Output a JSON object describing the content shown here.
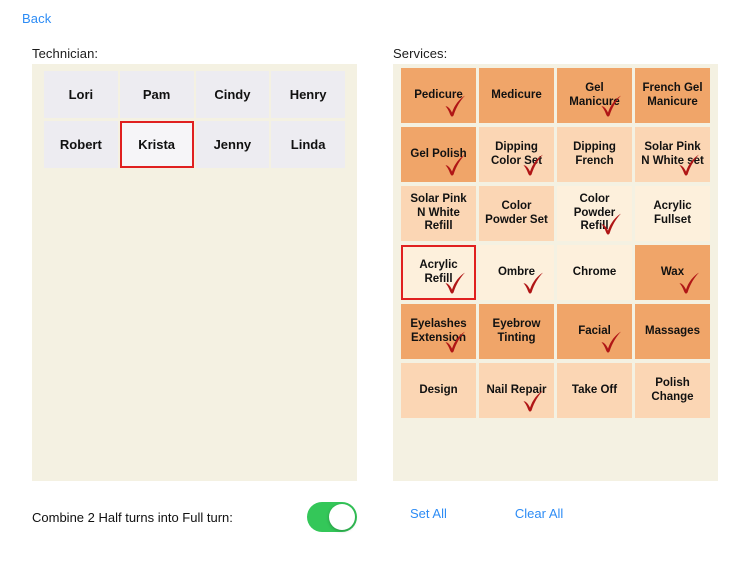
{
  "nav": {
    "back_label": "Back"
  },
  "technician": {
    "label": "Technician:",
    "selected": "Krista",
    "items": [
      {
        "name": "Lori",
        "selected": false
      },
      {
        "name": "Pam",
        "selected": false
      },
      {
        "name": "Cindy",
        "selected": false
      },
      {
        "name": "Henry",
        "selected": false
      },
      {
        "name": "Robert",
        "selected": false
      },
      {
        "name": "Krista",
        "selected": true
      },
      {
        "name": "Jenny",
        "selected": false
      },
      {
        "name": "Linda",
        "selected": false
      }
    ]
  },
  "services": {
    "label": "Services:",
    "items": [
      {
        "name": "Pedicure",
        "shade": 3,
        "checked": true,
        "outlined": false
      },
      {
        "name": "Medicure",
        "shade": 3,
        "checked": false,
        "outlined": false
      },
      {
        "name": "Gel Manicure",
        "shade": 3,
        "checked": true,
        "outlined": false
      },
      {
        "name": "French Gel Manicure",
        "shade": 3,
        "checked": false,
        "outlined": false
      },
      {
        "name": "Gel Polish",
        "shade": 3,
        "checked": true,
        "outlined": false
      },
      {
        "name": "Dipping Color Set",
        "shade": 2,
        "checked": true,
        "outlined": false
      },
      {
        "name": "Dipping French",
        "shade": 2,
        "checked": false,
        "outlined": false
      },
      {
        "name": "Solar Pink N White set",
        "shade": 2,
        "checked": true,
        "outlined": false
      },
      {
        "name": "Solar Pink N White Refill",
        "shade": 2,
        "checked": false,
        "outlined": false
      },
      {
        "name": "Color Powder Set",
        "shade": 2,
        "checked": false,
        "outlined": false
      },
      {
        "name": "Color Powder Refill",
        "shade": 1,
        "checked": true,
        "outlined": false
      },
      {
        "name": "Acrylic Fullset",
        "shade": 1,
        "checked": false,
        "outlined": false
      },
      {
        "name": "Acrylic Refill",
        "shade": 1,
        "checked": true,
        "outlined": true
      },
      {
        "name": "Ombre",
        "shade": 1,
        "checked": true,
        "outlined": false
      },
      {
        "name": "Chrome",
        "shade": 1,
        "checked": false,
        "outlined": false
      },
      {
        "name": "Wax",
        "shade": 3,
        "checked": true,
        "outlined": false
      },
      {
        "name": "Eyelashes Extension",
        "shade": 3,
        "checked": true,
        "outlined": false
      },
      {
        "name": "Eyebrow Tinting",
        "shade": 3,
        "checked": false,
        "outlined": false
      },
      {
        "name": "Facial",
        "shade": 3,
        "checked": true,
        "outlined": false
      },
      {
        "name": "Massages",
        "shade": 3,
        "checked": false,
        "outlined": false
      },
      {
        "name": "Design",
        "shade": 2,
        "checked": false,
        "outlined": false
      },
      {
        "name": "Nail Repair",
        "shade": 2,
        "checked": true,
        "outlined": false
      },
      {
        "name": "Take Off",
        "shade": 2,
        "checked": false,
        "outlined": false
      },
      {
        "name": "Polish Change",
        "shade": 2,
        "checked": false,
        "outlined": false
      }
    ]
  },
  "footer": {
    "combine_label": "Combine 2 Half turns into Full turn:",
    "combine_on": true,
    "set_all_label": "Set All",
    "clear_all_label": "Clear All"
  },
  "colors": {
    "accent_link": "#2d8cf5",
    "panel_bg": "#f4f1e2",
    "selection_outline": "#e02020",
    "check_mark": "#b01616",
    "toggle_on": "#34c759",
    "shade_3": "#f0a569",
    "shade_2": "#fbd6b4",
    "shade_1": "#fdf0dc",
    "tech_cell_bg": "#edecf1"
  }
}
